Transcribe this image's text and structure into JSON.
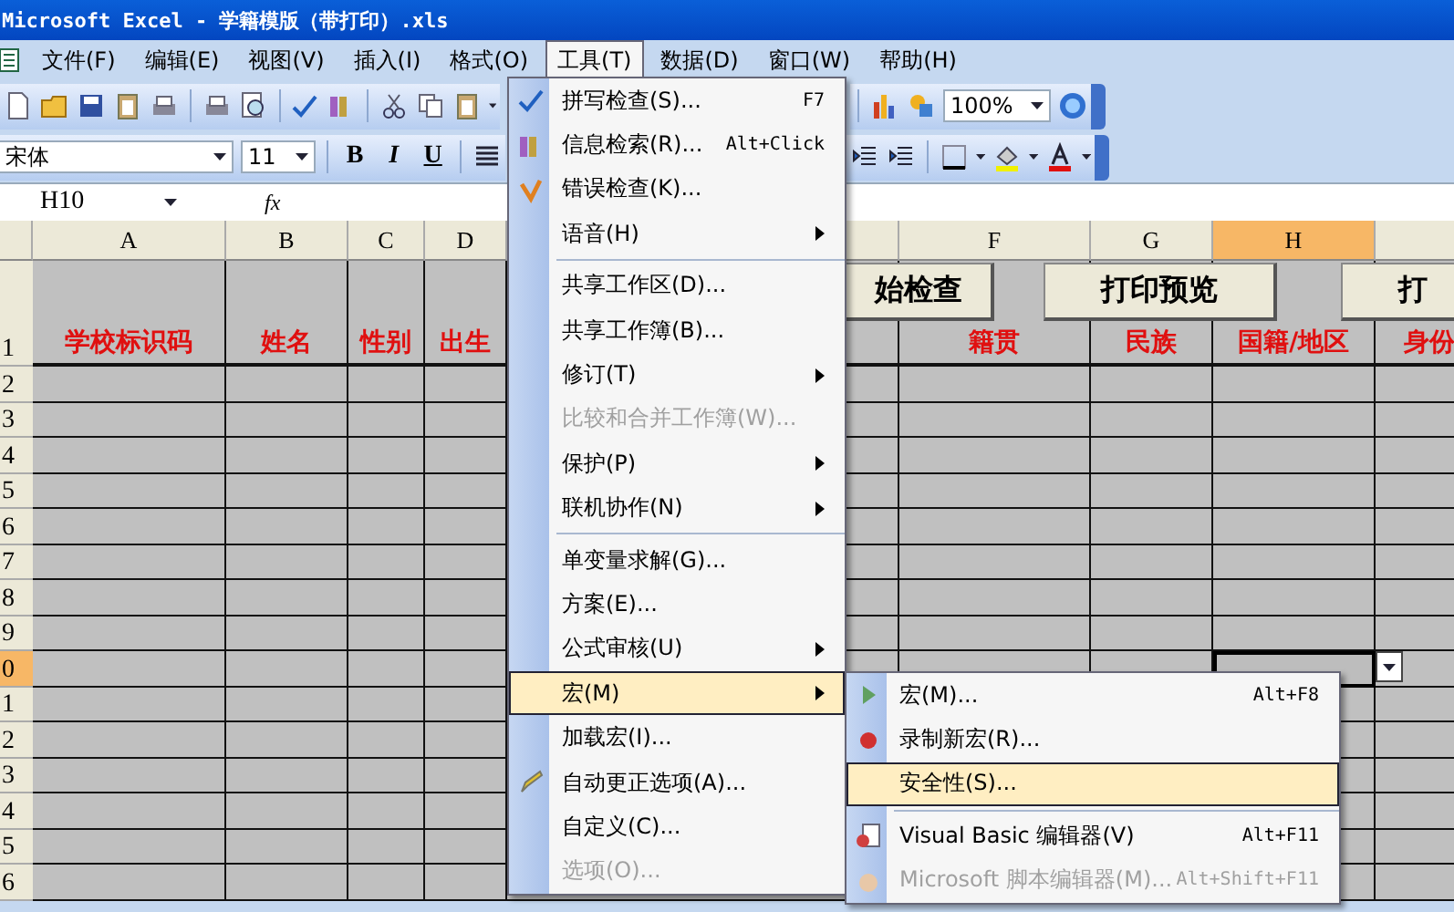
{
  "window": {
    "title": "Microsoft Excel - 学籍模版（带打印）.xls"
  },
  "menubar": {
    "items": [
      {
        "label": "文件(F)",
        "selected": false
      },
      {
        "label": "编辑(E)",
        "selected": false
      },
      {
        "label": "视图(V)",
        "selected": false
      },
      {
        "label": "插入(I)",
        "selected": false
      },
      {
        "label": "格式(O)",
        "selected": false
      },
      {
        "label": "工具(T)",
        "selected": true
      },
      {
        "label": "数据(D)",
        "selected": false
      },
      {
        "label": "窗口(W)",
        "selected": false
      },
      {
        "label": "帮助(H)",
        "selected": false
      }
    ]
  },
  "toolbar": {
    "zoom": "100%",
    "font": "宋体",
    "font_size": "11",
    "bold": "B",
    "italic": "I",
    "underline": "U"
  },
  "formula_bar": {
    "name_box": "H10",
    "fx": "fx"
  },
  "sheet": {
    "columns": [
      {
        "letter": "A",
        "header": "学校标识码",
        "selected": false
      },
      {
        "letter": "B",
        "header": "姓名",
        "selected": false
      },
      {
        "letter": "C",
        "header": "性别",
        "selected": false
      },
      {
        "letter": "D",
        "header": "出生",
        "selected": false
      },
      {
        "selected": false
      },
      {
        "letter": "F",
        "header": "籍贯",
        "selected": false
      },
      {
        "letter": "G",
        "header": "民族",
        "selected": false
      },
      {
        "letter": "H",
        "header": "国籍/地区",
        "selected": true
      },
      {
        "header": "身份",
        "selected": false
      }
    ],
    "rows": [
      {
        "number": "2",
        "selected": false
      },
      {
        "number": "3",
        "selected": false
      },
      {
        "number": "4",
        "selected": false
      },
      {
        "number": "5",
        "selected": false
      },
      {
        "number": "6",
        "selected": false
      },
      {
        "number": "7",
        "selected": false
      },
      {
        "number": "8",
        "selected": false
      },
      {
        "number": "9",
        "selected": false
      },
      {
        "number": "0",
        "selected": true
      },
      {
        "number": "1",
        "selected": false
      },
      {
        "number": "2",
        "selected": false
      },
      {
        "number": "3",
        "selected": false
      },
      {
        "number": "4",
        "selected": false
      },
      {
        "number": "5",
        "selected": false
      },
      {
        "number": "6",
        "selected": false
      }
    ],
    "header_row_number": "1",
    "buttons": [
      "始检查",
      "打印预览",
      "打"
    ]
  },
  "tools_menu": {
    "items": [
      {
        "kind": "command",
        "label": "拼写检查(S)...",
        "shortcut": "F7",
        "submenu": false,
        "selected": false,
        "disabled": false
      },
      {
        "kind": "command",
        "label": "信息检索(R)...",
        "shortcut": "Alt+Click",
        "submenu": false,
        "selected": false,
        "disabled": false
      },
      {
        "kind": "command",
        "label": "错误检查(K)...",
        "submenu": false,
        "selected": false,
        "disabled": false
      },
      {
        "kind": "command",
        "label": "语音(H)",
        "submenu": true,
        "selected": false,
        "disabled": false
      },
      {
        "kind": "separator"
      },
      {
        "kind": "command",
        "label": "共享工作区(D)...",
        "submenu": false,
        "selected": false,
        "disabled": false
      },
      {
        "kind": "command",
        "label": "共享工作簿(B)...",
        "submenu": false,
        "selected": false,
        "disabled": false
      },
      {
        "kind": "command",
        "label": "修订(T)",
        "submenu": true,
        "selected": false,
        "disabled": false
      },
      {
        "kind": "command",
        "label": "比较和合并工作簿(W)...",
        "submenu": false,
        "selected": false,
        "disabled": true
      },
      {
        "kind": "command",
        "label": "保护(P)",
        "submenu": true,
        "selected": false,
        "disabled": false
      },
      {
        "kind": "command",
        "label": "联机协作(N)",
        "submenu": true,
        "selected": false,
        "disabled": false
      },
      {
        "kind": "separator"
      },
      {
        "kind": "command",
        "label": "单变量求解(G)...",
        "submenu": false,
        "selected": false,
        "disabled": false
      },
      {
        "kind": "command",
        "label": "方案(E)...",
        "submenu": false,
        "selected": false,
        "disabled": false
      },
      {
        "kind": "command",
        "label": "公式审核(U)",
        "submenu": true,
        "selected": false,
        "disabled": false
      },
      {
        "kind": "command",
        "label": "宏(M)",
        "submenu": true,
        "selected": true,
        "disabled": false
      },
      {
        "kind": "command",
        "label": "加载宏(I)...",
        "submenu": false,
        "selected": false,
        "disabled": false
      },
      {
        "kind": "command",
        "label": "自动更正选项(A)...",
        "submenu": false,
        "selected": false,
        "disabled": false
      },
      {
        "kind": "command",
        "label": "自定义(C)...",
        "submenu": false,
        "selected": false,
        "disabled": false
      },
      {
        "kind": "command",
        "label": "选项(O)...",
        "submenu": false,
        "selected": false,
        "disabled": true
      }
    ]
  },
  "macro_menu": {
    "items": [
      {
        "kind": "command",
        "label": "宏(M)...",
        "shortcut": "Alt+F8",
        "selected": false,
        "disabled": false
      },
      {
        "kind": "command",
        "label": "录制新宏(R)...",
        "selected": false,
        "disabled": false
      },
      {
        "kind": "command",
        "label": "安全性(S)...",
        "selected": true,
        "disabled": false
      },
      {
        "kind": "separator"
      },
      {
        "kind": "command",
        "label": "Visual Basic 编辑器(V)",
        "shortcut": "Alt+F11",
        "selected": false,
        "disabled": false
      },
      {
        "kind": "command",
        "label": "Microsoft 脚本编辑器(M)...",
        "shortcut": "Alt+Shift+F11",
        "selected": false,
        "disabled": true
      }
    ]
  }
}
